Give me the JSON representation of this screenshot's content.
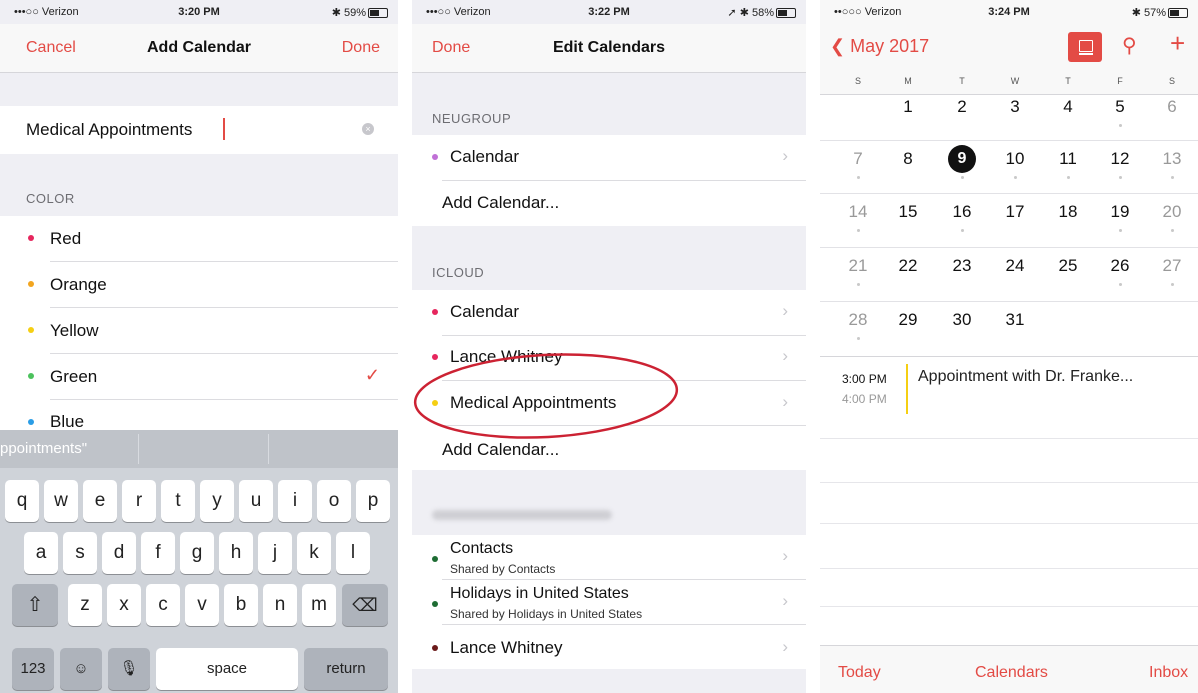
{
  "colors": {
    "accent": "#e34b45",
    "red": "#e6265d",
    "orange": "#f2a51f",
    "yellow": "#f5cf13",
    "green": "#4cc25d",
    "blue": "#2a9de6",
    "purple": "#c070d6",
    "dark_green": "#1e6c33",
    "maroon": "#6b1a1a",
    "circle": "#cc2233"
  },
  "screen1": {
    "status": {
      "carrier": "•••○○ Verizon",
      "time": "3:20 PM",
      "battery": "59%"
    },
    "nav": {
      "left": "Cancel",
      "title": "Add Calendar",
      "right": "Done"
    },
    "name_value": "Medical Appointments",
    "color_header": "COLOR",
    "colors": [
      {
        "label": "Red",
        "color": "#e6265d"
      },
      {
        "label": "Orange",
        "color": "#f2a51f"
      },
      {
        "label": "Yellow",
        "color": "#f5cf13"
      },
      {
        "label": "Green",
        "color": "#4cc25d",
        "selected": true
      },
      {
        "label": "Blue",
        "color": "#2a9de6"
      }
    ],
    "checkmark": "✓",
    "suggestion": "ppointments\"",
    "keyboard": {
      "row1": [
        "q",
        "w",
        "e",
        "r",
        "t",
        "y",
        "u",
        "i",
        "o",
        "p"
      ],
      "row2": [
        "a",
        "s",
        "d",
        "f",
        "g",
        "h",
        "j",
        "k",
        "l"
      ],
      "row3": [
        "z",
        "x",
        "c",
        "v",
        "b",
        "n",
        "m"
      ],
      "numbers": "123",
      "space": "space",
      "return": "return"
    }
  },
  "screen2": {
    "status": {
      "carrier": "•••○○ Verizon",
      "time": "3:22 PM",
      "battery": "58%"
    },
    "nav": {
      "left": "Done",
      "title": "Edit Calendars"
    },
    "sections": [
      {
        "header": "NEUGROUP",
        "items": [
          {
            "label": "Calendar",
            "color": "#c070d6"
          }
        ],
        "add": "Add Calendar..."
      },
      {
        "header": "ICLOUD",
        "items": [
          {
            "label": "Calendar",
            "color": "#e6265d"
          },
          {
            "label": "Lance Whitney",
            "color": "#e6265d"
          },
          {
            "label": "Medical Appointments",
            "color": "#f5cf13"
          }
        ],
        "add": "Add Calendar..."
      }
    ],
    "other_items": [
      {
        "label": "Contacts",
        "sub": "Shared by Contacts",
        "color": "#1e6c33"
      },
      {
        "label": "Holidays in United States",
        "sub": "Shared by Holidays in United States",
        "color": "#1e6c33"
      },
      {
        "label": "Lance Whitney",
        "color": "#6b1a1a"
      }
    ]
  },
  "screen3": {
    "status": {
      "carrier": "••○○○ Verizon",
      "time": "3:24 PM",
      "battery": "57%"
    },
    "month": "May 2017",
    "weekdays": [
      "S",
      "M",
      "T",
      "W",
      "T",
      "F",
      "S"
    ],
    "weeks": [
      [
        "",
        "1",
        "2",
        "3",
        "4",
        "5",
        "6"
      ],
      [
        "7",
        "8",
        "9",
        "10",
        "11",
        "12",
        "13"
      ],
      [
        "14",
        "15",
        "16",
        "17",
        "18",
        "19",
        "20"
      ],
      [
        "21",
        "22",
        "23",
        "24",
        "25",
        "26",
        "27"
      ],
      [
        "28",
        "29",
        "30",
        "31",
        "",
        "",
        ""
      ]
    ],
    "today": "9",
    "event": {
      "start": "3:00 PM",
      "end": "4:00 PM",
      "title": "Appointment with Dr. Franke..."
    },
    "tabs": {
      "today": "Today",
      "calendars": "Calendars",
      "inbox": "Inbox"
    }
  }
}
